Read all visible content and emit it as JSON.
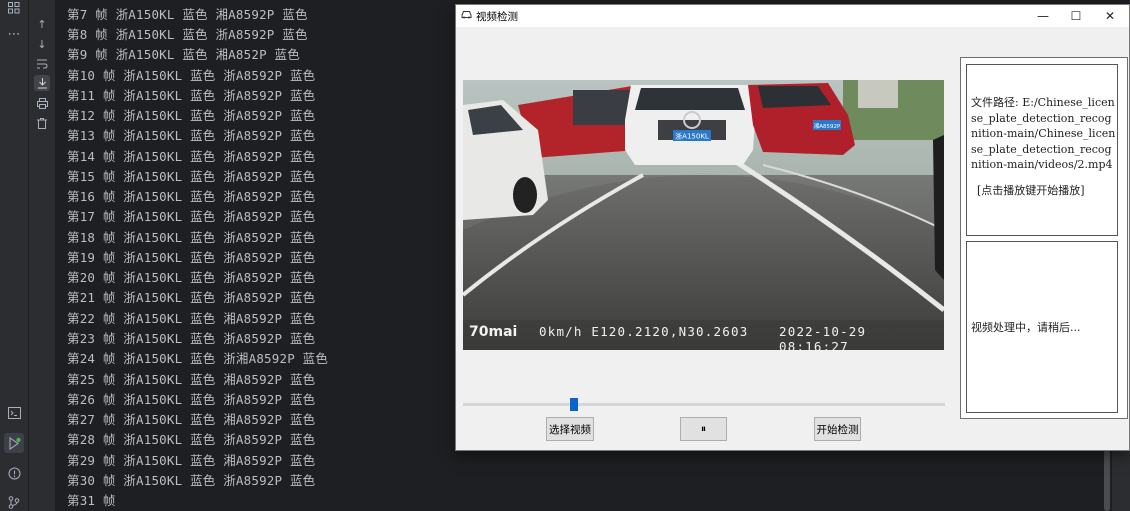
{
  "console": {
    "lines": [
      "第7 帧 浙A150KL 蓝色 湘A8592P 蓝色",
      "第8 帧 浙A150KL 蓝色 浙A8592P 蓝色",
      "第9 帧 浙A150KL 蓝色 湘A852P 蓝色",
      "第10 帧 浙A150KL 蓝色 浙A8592P 蓝色",
      "第11 帧 浙A150KL 蓝色 浙A8592P 蓝色",
      "第12 帧 浙A150KL 蓝色 浙A8592P 蓝色",
      "第13 帧 浙A150KL 蓝色 浙A8592P 蓝色",
      "第14 帧 浙A150KL 蓝色 浙A8592P 蓝色",
      "第15 帧 浙A150KL 蓝色 浙A8592P 蓝色",
      "第16 帧 浙A150KL 蓝色 浙A8592P 蓝色",
      "第17 帧 浙A150KL 蓝色 浙A8592P 蓝色",
      "第18 帧 浙A150KL 蓝色 浙A8592P 蓝色",
      "第19 帧 浙A150KL 蓝色 浙A8592P 蓝色",
      "第20 帧 浙A150KL 蓝色 浙A8592P 蓝色",
      "第21 帧 浙A150KL 蓝色 浙A8592P 蓝色",
      "第22 帧 浙A150KL 蓝色 湘A8592P 蓝色",
      "第23 帧 浙A150KL 蓝色 浙A8592P 蓝色",
      "第24 帧 浙A150KL 蓝色 浙湘A8592P 蓝色",
      "第25 帧 浙A150KL 蓝色 湘A8592P 蓝色",
      "第26 帧 浙A150KL 蓝色 浙A8592P 蓝色",
      "第27 帧 浙A150KL 蓝色 湘A8592P 蓝色",
      "第28 帧 浙A150KL 蓝色 浙A8592P 蓝色",
      "第29 帧 浙A150KL 蓝色 湘A8592P 蓝色",
      "第30 帧 浙A150KL 蓝色 浙A8592P 蓝色",
      "第31 帧"
    ]
  },
  "window": {
    "title": "视频检测",
    "icon": "car-icon",
    "minimize_glyph": "—",
    "maximize_glyph": "☐",
    "close_glyph": "✕"
  },
  "video": {
    "brand": "70mai",
    "speed_coords": "0km/h E120.2120,N30.2603",
    "datetime": "2022-10-29 08:16:27",
    "plate_front": "浙A150KL",
    "plate_right": "湘A8592P"
  },
  "info": {
    "path_text": "文件路径: E:/Chinese_license_plate_detection_recognition-main/Chinese_license_plate_detection_recognition-main/videos/2.mp4",
    "hint_text": "[点击播放键开始播放]",
    "status_text": "视频处理中，请稍后..."
  },
  "controls": {
    "progress": 0.23,
    "select_label": "选择视频",
    "pause_label": "⏸",
    "detect_label": "开始检测"
  },
  "colors": {
    "accent": "#0a64c8",
    "console_bg": "#1e1f22",
    "console_text": "#bcbec4",
    "run_indicator": "#4caf50"
  }
}
